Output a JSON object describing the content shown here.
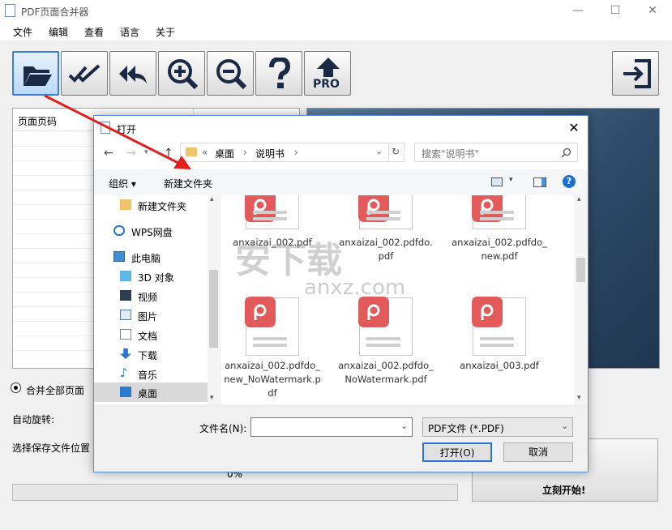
{
  "app": {
    "title": "PDF页面合并器",
    "min": "—",
    "max": "☐",
    "close": "✕"
  },
  "menu": [
    "文件",
    "编辑",
    "查看",
    "语言",
    "关于"
  ],
  "toolbar": {
    "pro_label": "PRO"
  },
  "pagelist": {
    "header": "页面页码"
  },
  "options": {
    "merge_all": "合并全部页面",
    "auto_rotate": "自动旋转:",
    "save_location": "选择保存文件位置",
    "progress": "0%",
    "progress_value": 0
  },
  "start_button": "立刻开始!",
  "dialog": {
    "title": "打开",
    "close": "✕",
    "back": "←",
    "forward": "→",
    "up": "↑",
    "address": {
      "prefix": "«",
      "parts": [
        "桌面",
        "›",
        "说明书",
        "›"
      ]
    },
    "refresh": "↻",
    "search_placeholder": "搜索\"说明书\"",
    "organize": "组织 ▾",
    "new_folder": "新建文件夹",
    "nav": [
      {
        "label": "新建文件夹",
        "icon": "folder-icon"
      },
      {
        "label": "WPS网盘",
        "icon": "cloud-icon"
      },
      {
        "label": "此电脑",
        "icon": "computer-icon"
      },
      {
        "label": "3D 对象",
        "icon": "cube-icon"
      },
      {
        "label": "视频",
        "icon": "video-icon"
      },
      {
        "label": "图片",
        "icon": "picture-icon"
      },
      {
        "label": "文档",
        "icon": "document-icon"
      },
      {
        "label": "下载",
        "icon": "download-icon"
      },
      {
        "label": "音乐",
        "icon": "music-icon"
      },
      {
        "label": "桌面",
        "icon": "desktop-icon"
      }
    ],
    "files": [
      {
        "name": "anxaizai_002.pdf"
      },
      {
        "name": "anxaizai_002.pdfdo.pdf"
      },
      {
        "name": "anxaizai_002.pdfdo_new.pdf"
      },
      {
        "name": "anxaizai_002.pdfdo_new_NoWatermark.pdf"
      },
      {
        "name": "anxaizai_002.pdfdo_NoWatermark.pdf"
      },
      {
        "name": "anxaizai_003.pdf"
      }
    ],
    "filename_label": "文件名(N):",
    "filename_value": "",
    "filetype": "PDF文件 (*.PDF)",
    "open_button": "打开(O)",
    "cancel_button": "取消"
  },
  "watermark": {
    "line1": "安下载",
    "line2": "anxz.com"
  },
  "colors": {
    "accent": "#2a73d4",
    "pdf_red": "#e25a5a",
    "arrow_red": "#e02020"
  }
}
